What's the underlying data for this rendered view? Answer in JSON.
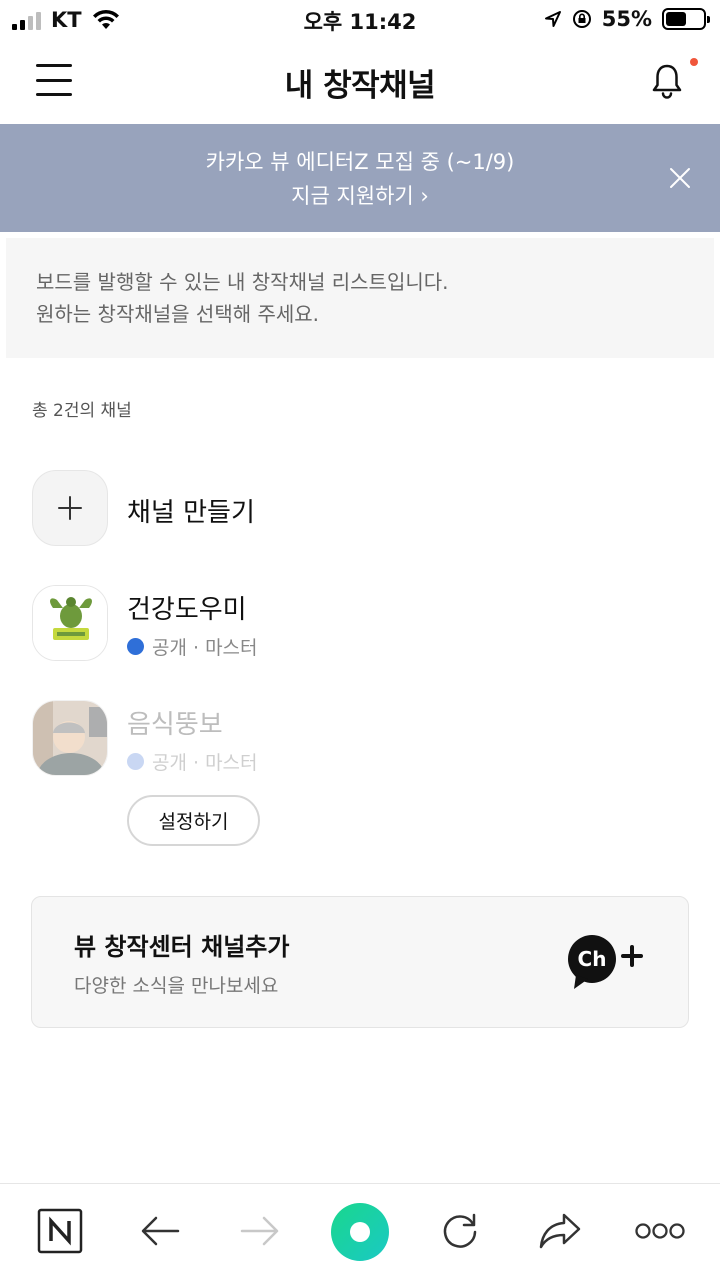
{
  "status_bar": {
    "carrier": "KT",
    "time": "오후 11:42",
    "battery": "55%",
    "battery_level": 0.55
  },
  "header": {
    "title": "내 창작채널"
  },
  "banner": {
    "line1": "카카오 뷰 에디터Z 모집 중 (~1/9)",
    "line2": "지금 지원하기 ›"
  },
  "info": {
    "line1": "보드를 발행할 수 있는 내 창작채널 리스트입니다.",
    "line2": "원하는 창작채널을 선택해 주세요."
  },
  "count_text": "총 2건의 채널",
  "create_channel": {
    "label": "채널 만들기"
  },
  "channels": [
    {
      "name": "건강도우미",
      "status": "공개 · 마스터",
      "dot_color": "#2f6fd8"
    },
    {
      "name": "음식뚱보",
      "status": "공개 · 마스터",
      "dot_color": "#c9d7f3"
    }
  ],
  "setup_button": "설정하기",
  "promo": {
    "title": "뷰 창작센터 채널추가",
    "subtitle": "다양한 소식을 만나보세요",
    "icon_text": "Ch"
  },
  "colors": {
    "banner_bg": "#98a3bc",
    "accent_green": "#1ed69d",
    "notification_dot": "#f0563b"
  }
}
